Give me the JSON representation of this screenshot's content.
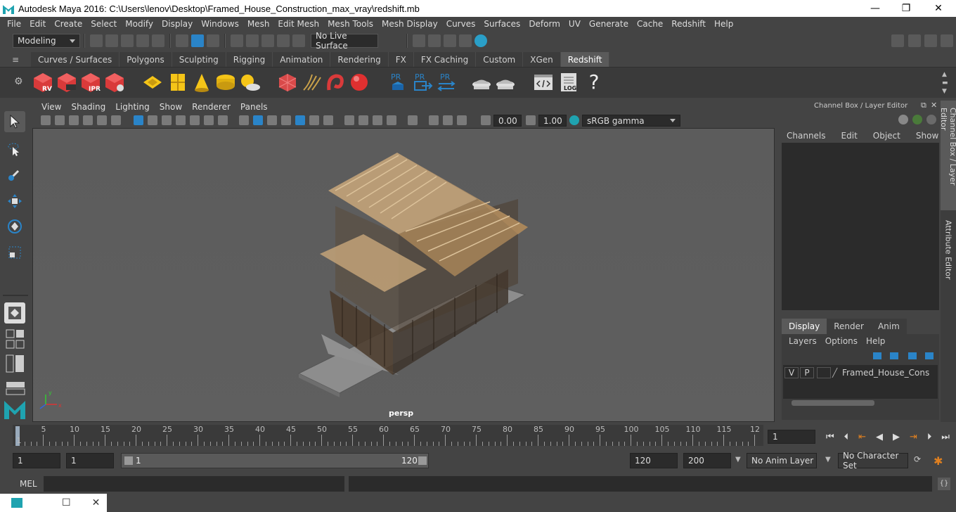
{
  "window": {
    "title": "Autodesk Maya 2016: C:\\Users\\lenov\\Desktop\\Framed_House_Construction_max_vray\\redshift.mb",
    "minimize_glyph": "—",
    "maximize_glyph": "❐",
    "close_glyph": "✕"
  },
  "menu": {
    "items": [
      "File",
      "Edit",
      "Create",
      "Select",
      "Modify",
      "Display",
      "Windows",
      "Mesh",
      "Edit Mesh",
      "Mesh Tools",
      "Mesh Display",
      "Curves",
      "Surfaces",
      "Deform",
      "UV",
      "Generate",
      "Cache",
      "Redshift",
      "Help"
    ]
  },
  "status": {
    "mode": "Modeling",
    "live_surface": "No Live Surface"
  },
  "shelf": {
    "tabs": [
      "Curves / Surfaces",
      "Polygons",
      "Sculpting",
      "Rigging",
      "Animation",
      "Rendering",
      "FX",
      "FX Caching",
      "Custom",
      "XGen",
      "Redshift"
    ],
    "active_tab": "Redshift",
    "rv": "RV",
    "ipr": "IPR",
    "pr1": "PR",
    "pr2": "PR",
    "pr3": "PR",
    "log": "LOG",
    "help": "?"
  },
  "panel": {
    "menus": [
      "View",
      "Shading",
      "Lighting",
      "Show",
      "Renderer",
      "Panels"
    ],
    "exposure": "0.00",
    "gamma": "1.00",
    "colorspace": "sRGB gamma",
    "camera": "persp",
    "axis_x": "x",
    "axis_y": "y"
  },
  "channel_box": {
    "header": "Channel Box / Layer Editor",
    "menus": [
      "Channels",
      "Edit",
      "Object",
      "Show"
    ],
    "layer_tabs": [
      "Display",
      "Render",
      "Anim"
    ],
    "layer_menus": [
      "Layers",
      "Options",
      "Help"
    ],
    "layer": {
      "v": "V",
      "p": "P",
      "name": "Framed_House_Construc"
    }
  },
  "side_tabs": [
    "Channel Box / Layer Editor",
    "Attribute Editor"
  ],
  "timeline": {
    "ticks": [
      "5",
      "10",
      "15",
      "20",
      "25",
      "30",
      "35",
      "40",
      "45",
      "50",
      "55",
      "60",
      "65",
      "70",
      "75",
      "80",
      "85",
      "90",
      "95",
      "100",
      "105",
      "110",
      "115",
      "12"
    ],
    "first_frame": "1",
    "current_frame": "1"
  },
  "range": {
    "start": "1",
    "playback_start": "1",
    "slider_start": "1",
    "slider_end": "120",
    "playback_end": "120",
    "end": "200",
    "anim_layer": "No Anim Layer",
    "char_set": "No Character Set"
  },
  "cmd": {
    "label": "MEL"
  },
  "colors": {
    "accent": "#5a5a5a",
    "viewport": "#5e5e5e",
    "wood": "#c9a77a",
    "select_blue": "#2a84c8"
  }
}
